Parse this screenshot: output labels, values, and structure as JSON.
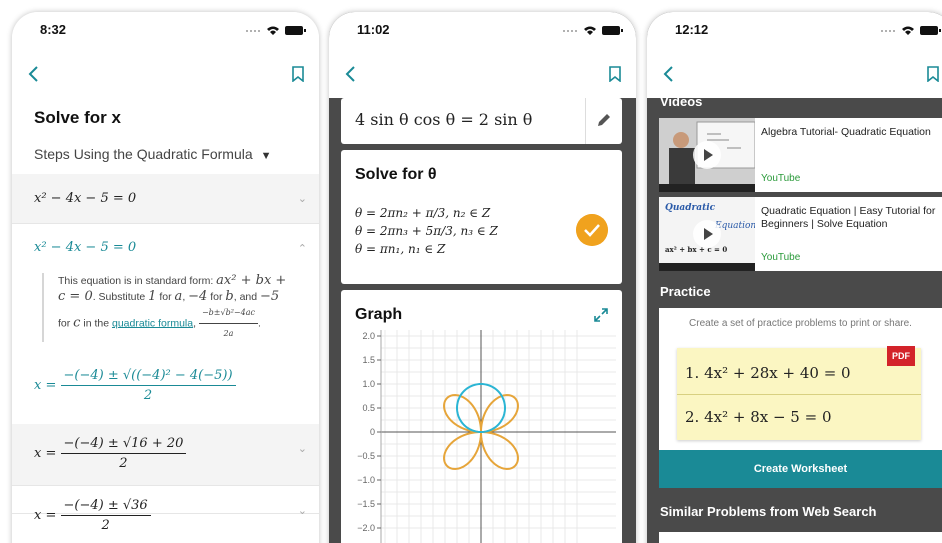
{
  "phone1": {
    "status": {
      "time": "8:32"
    },
    "title": "Solve for x",
    "method": {
      "label": "Steps Using the Quadratic Formula",
      "caret": "▼"
    },
    "rows": [
      {
        "eq": "x² − 4x − 5 = 0"
      },
      {
        "eq": "x² − 4x − 5 = 0"
      }
    ],
    "explanation": {
      "part1": "This equation is in standard form: ",
      "std_form": "ax² + bx + c = 0",
      "part2": ". Substitute ",
      "v1": "1",
      "part3": " for ",
      "a": "a",
      "part4": ", ",
      "v2": "−4",
      "part5": " for ",
      "b": "b",
      "part6": ", and ",
      "v3": "−5",
      "part7": " for ",
      "c": "c",
      "part8": " in the ",
      "link": "quadratic formula",
      "part9": ", ",
      "formula_num": "−b±√b²−4ac",
      "formula_den": "2a",
      "part10": "."
    },
    "steps": [
      {
        "lhs": "x =",
        "num": "−(−4) ± √((−4)² − 4(−5))",
        "den": "2"
      },
      {
        "lhs": "x =",
        "num": "−(−4) ± √16 + 20",
        "den": "2"
      },
      {
        "lhs": "x =",
        "num": "−(−4) ± √36",
        "den": "2"
      }
    ]
  },
  "phone2": {
    "status": {
      "time": "11:02"
    },
    "input_eq": "4 sin θ cos θ = 2 sin θ",
    "solve_title": "Solve for θ",
    "solutions": [
      "θ = 2πn₂ + π/3, n₂ ∈ Z",
      "θ = 2πn₃ + 5π/3, n₃ ∈ Z",
      "θ = πn₁, n₁ ∈ Z"
    ],
    "graph_title": "Graph",
    "y_ticks": [
      "2.0",
      "1.5",
      "1.0",
      "0.5",
      "0",
      "−0.5",
      "−1.0",
      "−1.5",
      "−2.0"
    ],
    "chart_data": {
      "type": "line",
      "title": "Graph",
      "ylim": [
        -2.0,
        2.0
      ],
      "series": [
        {
          "equation": "r = 2 sin θ",
          "color": "#2bb5d4"
        },
        {
          "equation": "r = 4 sin θ cos θ",
          "color": "#e6a53a"
        }
      ]
    }
  },
  "phone3": {
    "status": {
      "time": "12:12"
    },
    "videos_header": "Videos",
    "videos": [
      {
        "title": "Algebra Tutorial- Quadratic Equation",
        "source": "YouTube"
      },
      {
        "title": "Quadratic Equation | Easy Tutorial for Beginners | Solve Equation",
        "source": "YouTube",
        "thumb_text1": "Quadratic",
        "thumb_text2": "Equation",
        "thumb_text3": "ax² + bx + c = 0"
      }
    ],
    "practice_header": "Practice",
    "practice_sub": "Create a set of practice problems to print or share.",
    "problems": [
      "1. 4x² + 28x + 40 = 0",
      "2. 4x² + 8x − 5 = 0"
    ],
    "pdf_label": "PDF",
    "create_button": "Create Worksheet",
    "similar_header": "Similar Problems from Web Search"
  },
  "colors": {
    "accent": "#1a8a96",
    "orange": "#e6a53a",
    "cyan": "#2bb5d4",
    "dark": "#4a4a4a"
  }
}
